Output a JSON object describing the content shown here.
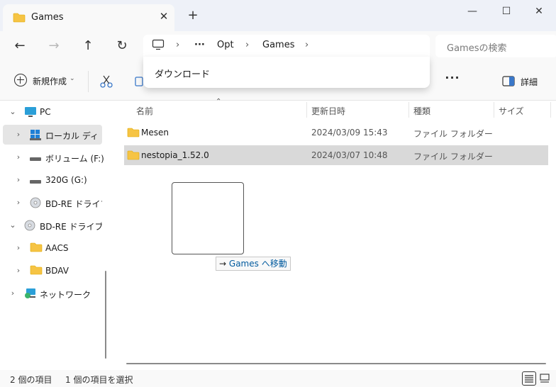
{
  "window": {
    "tab_title": "Games",
    "tab_close_glyph": "✕",
    "new_tab_glyph": "+",
    "minimize_glyph": "—",
    "maximize_glyph": "☐",
    "close_glyph": "✕"
  },
  "nav": {
    "back_glyph": "←",
    "forward_glyph": "→",
    "up_glyph": "↑",
    "refresh_glyph": "↻"
  },
  "address": {
    "ellipsis": "···",
    "segments": [
      "Opt",
      "Games"
    ],
    "separator": "›"
  },
  "search": {
    "placeholder": "Gamesの検索"
  },
  "dropdown": {
    "items": [
      "ダウンロード"
    ]
  },
  "commands": {
    "new_label": "新規作成",
    "more_glyph": "···",
    "details_label": "詳細"
  },
  "sidebar": {
    "items": [
      {
        "label": "PC",
        "icon": "pc-icon"
      },
      {
        "label": "ローカル ディスク",
        "icon": "drive-icon"
      },
      {
        "label": "ボリューム (F:)",
        "icon": "drive-icon"
      },
      {
        "label": "320G (G:)",
        "icon": "drive-icon"
      },
      {
        "label": "BD-RE ドライブ (",
        "icon": "disc-icon"
      },
      {
        "label": "BD-RE ドライブ (H",
        "icon": "disc-icon"
      },
      {
        "label": "AACS",
        "icon": "folder-icon"
      },
      {
        "label": "BDAV",
        "icon": "folder-icon"
      },
      {
        "label": "ネットワーク",
        "icon": "network-icon"
      }
    ]
  },
  "columns": {
    "name": "名前",
    "modified": "更新日時",
    "type": "種類",
    "size": "サイズ"
  },
  "files": [
    {
      "name": "Mesen",
      "modified": "2024/03/09 15:43",
      "type": "ファイル フォルダー"
    },
    {
      "name": "nestopia_1.52.0",
      "modified": "2024/03/07 10:48",
      "type": "ファイル フォルダー"
    }
  ],
  "drag": {
    "arrow": "→",
    "target": "Games",
    "action": "へ移動"
  },
  "status": {
    "item_count": "2 個の項目",
    "selection": "1 個の項目を選択"
  },
  "colors": {
    "folder": "#f6c444",
    "accent": "#005a9e",
    "selected_row": "#d9d9d9"
  }
}
